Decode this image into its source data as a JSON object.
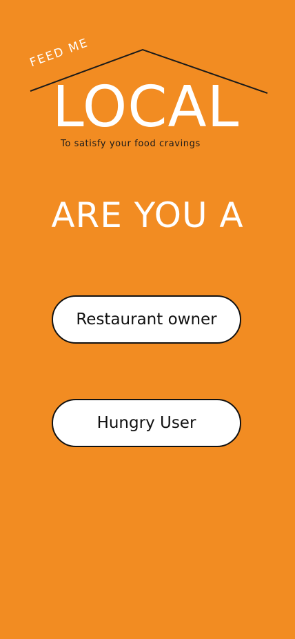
{
  "logo": {
    "top_text": "FEED ME",
    "main_text": "LOCAL",
    "tagline": "To satisfy your food cravings"
  },
  "prompt": {
    "question": "ARE YOU A"
  },
  "options": {
    "restaurant_owner_label": "Restaurant owner",
    "hungry_user_label": "Hungry User"
  },
  "colors": {
    "background": "#F28C22",
    "button_background": "#FFFFFF",
    "button_border": "#111111",
    "logo_text": "#FFFFFF",
    "tagline_text": "#1A1A1A"
  }
}
